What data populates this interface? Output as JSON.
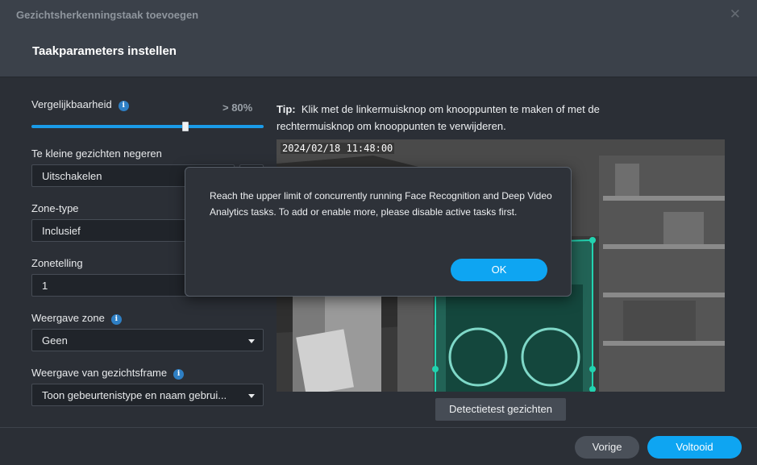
{
  "window": {
    "title": "Gezichtsherkenningstaak toevoegen",
    "close_glyph": "✕"
  },
  "header": {
    "title": "Taakparameters instellen"
  },
  "form": {
    "similarity": {
      "label": "Vergelijkbaarheid",
      "value_text": "> 80%",
      "value": 80
    },
    "ignore_small": {
      "label": "Te kleine gezichten negeren",
      "value": "Uitschakelen"
    },
    "zone_type": {
      "label": "Zone-type",
      "value": "Inclusief"
    },
    "zone_count": {
      "label": "Zonetelling",
      "value": "1"
    },
    "zone_display": {
      "label": "Weergave zone",
      "value": "Geen"
    },
    "face_frame_display": {
      "label": "Weergave van gezichtsframe",
      "value": "Toon gebeurtenistype en naam gebrui..."
    }
  },
  "tip": {
    "prefix": "Tip:",
    "text": "Klik met de linkermuisknop om knooppunten te maken of met de rechtermuisknop om knooppunten te verwijderen."
  },
  "video": {
    "timestamp": "2024/02/18 11:48:00",
    "zone_color": "#22d3b0"
  },
  "buttons": {
    "detect": "Detectietest gezichten",
    "previous": "Vorige",
    "finish": "Voltooid"
  },
  "alert": {
    "message": "Reach the upper limit of concurrently running Face Recognition and Deep Video Analytics tasks. To add or enable more, please disable active tasks first.",
    "ok": "OK"
  },
  "colors": {
    "accent": "#0ea5f2",
    "info": "#2e7fc4"
  }
}
